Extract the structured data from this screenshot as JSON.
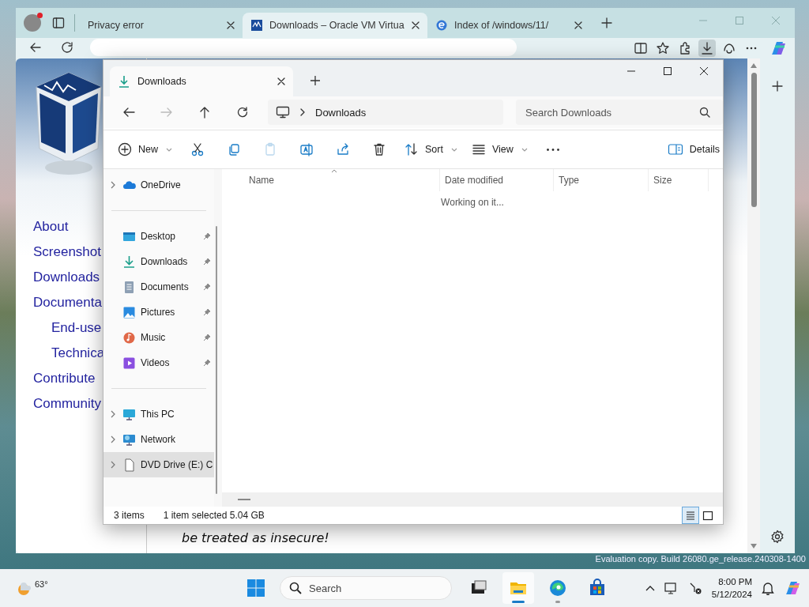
{
  "browser": {
    "tabs": [
      {
        "title": "Privacy error",
        "selected": false
      },
      {
        "title": "Downloads – Oracle VM Virtua",
        "selected": true,
        "kind": "vbox"
      },
      {
        "title": "Index of /windows/11/",
        "selected": false,
        "kind": "ie"
      }
    ],
    "toolbar_buttons": [
      {
        "kind": "split",
        "active": false
      },
      {
        "kind": "favorites",
        "active": false
      },
      {
        "kind": "extensions",
        "active": false
      },
      {
        "kind": "downloads",
        "active": true
      },
      {
        "kind": "copilot",
        "active": false
      },
      {
        "kind": "more",
        "active": false
      }
    ],
    "nav_links": [
      {
        "label": "About"
      },
      {
        "label": "Screenshot"
      },
      {
        "label": "Downloads"
      },
      {
        "label": "Documenta",
        "children": [
          {
            "label": "End-use"
          },
          {
            "label": "Technica"
          }
        ]
      },
      {
        "label": "Contribute"
      },
      {
        "label": "Community"
      }
    ],
    "page_text": "be treated as insecure!"
  },
  "explorer": {
    "tab_title": "Downloads",
    "nav_buttons": [
      {
        "kind": "back",
        "disabled": false
      },
      {
        "kind": "forward",
        "disabled": true
      },
      {
        "kind": "up",
        "disabled": false
      },
      {
        "kind": "refresh",
        "disabled": false
      }
    ],
    "breadcrumb": "Downloads",
    "search": {
      "placeholder": "Search Downloads"
    },
    "commands": [
      {
        "kind": "new",
        "label": "New",
        "dropdown": true,
        "disabled": false
      },
      {
        "kind": "cut",
        "disabled": false
      },
      {
        "kind": "copy",
        "disabled": false
      },
      {
        "kind": "paste",
        "disabled": true
      },
      {
        "kind": "rename",
        "disabled": false
      },
      {
        "kind": "share",
        "disabled": false
      },
      {
        "kind": "delete",
        "disabled": false
      },
      {
        "kind": "sort",
        "label": "Sort",
        "dropdown": true,
        "disabled": false
      },
      {
        "kind": "view",
        "label": "View",
        "dropdown": true,
        "disabled": false
      },
      {
        "kind": "more",
        "disabled": false
      }
    ],
    "details_button": "Details",
    "sidebar": {
      "sections": [
        {
          "items": [
            {
              "label": "OneDrive",
              "kind": "onedrive",
              "expandable": true,
              "pinned": false,
              "selected": false
            }
          ]
        },
        {
          "items": [
            {
              "label": "Desktop",
              "kind": "desktop",
              "expandable": false,
              "pinned": true,
              "selected": false
            },
            {
              "label": "Downloads",
              "kind": "downloads",
              "expandable": false,
              "pinned": true,
              "selected": false
            },
            {
              "label": "Documents",
              "kind": "documents",
              "expandable": false,
              "pinned": true,
              "selected": false
            },
            {
              "label": "Pictures",
              "kind": "pictures",
              "expandable": false,
              "pinned": true,
              "selected": false
            },
            {
              "label": "Music",
              "kind": "music",
              "expandable": false,
              "pinned": true,
              "selected": false
            },
            {
              "label": "Videos",
              "kind": "videos",
              "expandable": false,
              "pinned": true,
              "selected": false
            }
          ]
        },
        {
          "items": [
            {
              "label": "This PC",
              "kind": "thispc",
              "expandable": true,
              "pinned": false,
              "selected": false
            },
            {
              "label": "Network",
              "kind": "network",
              "expandable": true,
              "pinned": false,
              "selected": false
            },
            {
              "label": "DVD Drive (E:) C",
              "kind": "dvd",
              "expandable": true,
              "pinned": false,
              "selected": true
            }
          ]
        }
      ]
    },
    "columns": [
      {
        "label": "Name",
        "sorted": true
      },
      {
        "label": "Date modified",
        "sorted": false
      },
      {
        "label": "Type",
        "sorted": false
      },
      {
        "label": "Size",
        "sorted": false
      }
    ],
    "status_message": "Working on it...",
    "status_bar": {
      "item_count": "3 items",
      "selection": "1 item selected  5.04 GB"
    },
    "view_modes": [
      {
        "kind": "details",
        "selected": true
      },
      {
        "kind": "tiles",
        "selected": false
      }
    ]
  },
  "desktop_notice": "Evaluation copy. Build 26080.ge_release.240308-1400",
  "taskbar": {
    "weather": "63°",
    "search_placeholder": "Search",
    "apps": [
      {
        "kind": "taskview",
        "running": false,
        "active": false
      },
      {
        "kind": "explorer",
        "running": true,
        "active": true
      },
      {
        "kind": "edge",
        "running": true,
        "active": false
      },
      {
        "kind": "store",
        "running": false,
        "active": false
      }
    ],
    "time": "8:00 PM",
    "date": "5/12/2024"
  }
}
